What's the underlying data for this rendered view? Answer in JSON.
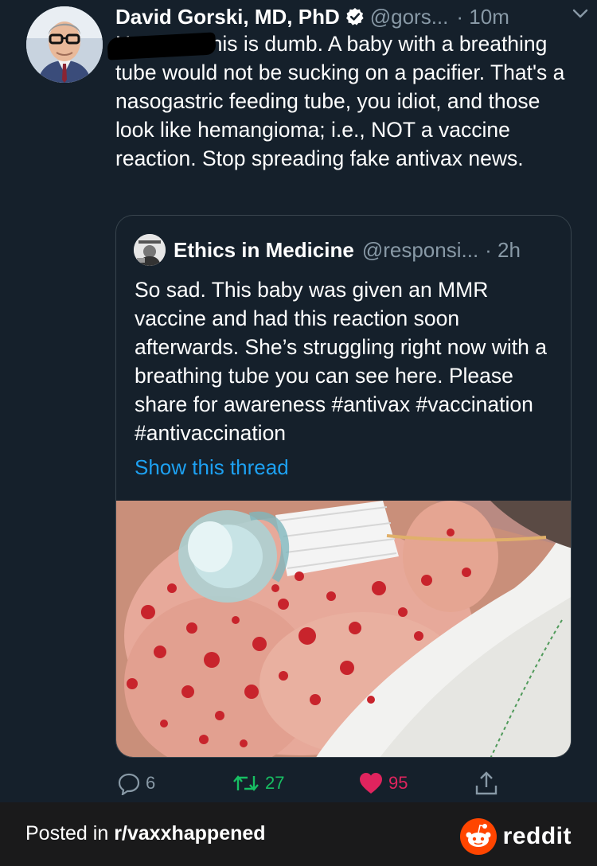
{
  "tweet": {
    "author_name": "David Gorski, MD, PhD",
    "handle": "@gors...",
    "time": "· 10m",
    "icons": {
      "verified": "verified-badge-icon",
      "menu": "chevron-down-icon"
    },
    "text": "H            n, this is dumb. A baby with a breathing tube would not be sucking on a pacifier. That's a nasogastric feeding tube, you idiot, and those look like hemangioma; i.e., NOT a vaccine reaction. Stop spreading fake antivax news.",
    "quote": {
      "author_name": "Ethics in Medicine",
      "handle": "@responsi...",
      "time": "· 2h",
      "text": "So sad. This baby was given an MMR vaccine and had this reaction soon afterwards. She’s struggling right now with a breathing tube you can see here. Please share for awareness #antivax #vaccination #antivaccination",
      "show_thread": "Show this thread"
    },
    "actions": {
      "replies": "6",
      "retweets": "27",
      "likes": "95"
    },
    "colors": {
      "background": "#15202b",
      "link": "#1da1f2",
      "retweet": "#17bf63",
      "like": "#e0245e",
      "muted": "#8899a6"
    }
  },
  "footer": {
    "posted_prefix": "Posted in ",
    "subreddit": "r/vaxxhappened",
    "brand": "reddit"
  }
}
